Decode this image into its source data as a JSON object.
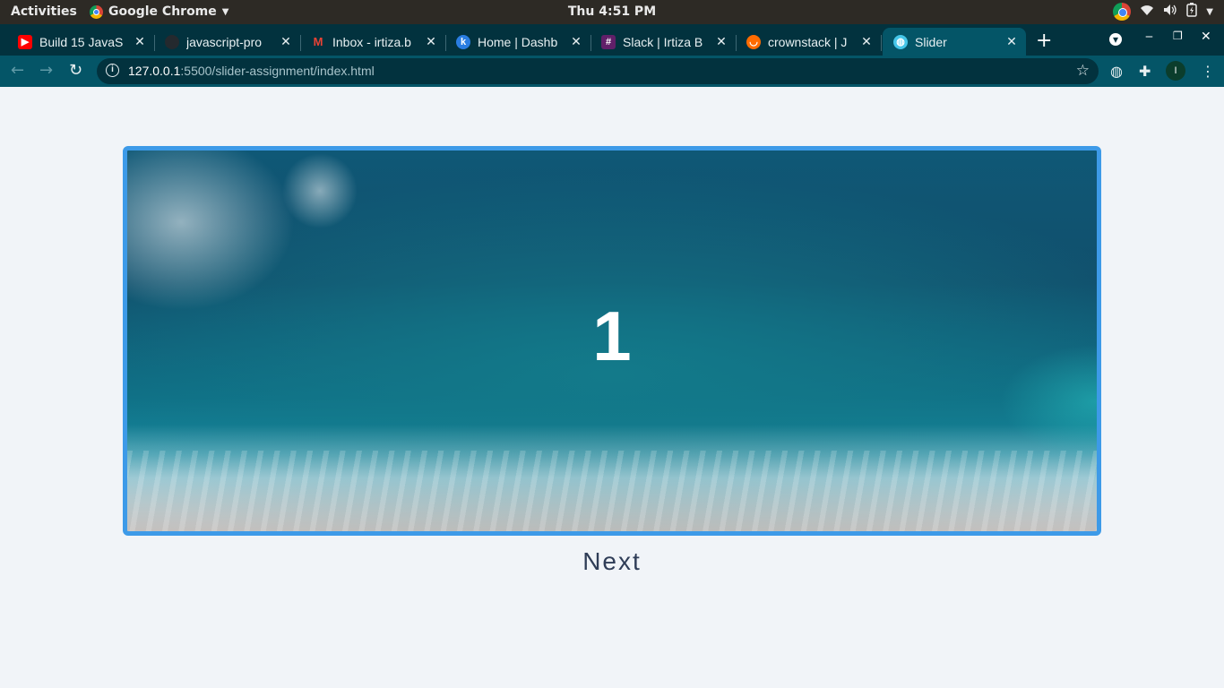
{
  "system_bar": {
    "activities": "Activities",
    "app_name": "Google Chrome",
    "clock": "Thu  4:51 PM"
  },
  "browser": {
    "tabs": [
      {
        "title": "Build 15 JavaS",
        "favicon": "youtube-icon",
        "color": "#ff0000"
      },
      {
        "title": "javascript-pro",
        "favicon": "github-icon",
        "color": "#24292e"
      },
      {
        "title": "Inbox - irtiza.b",
        "favicon": "gmail-icon",
        "color": "#ea4335"
      },
      {
        "title": "Home | Dashb",
        "favicon": "k-icon",
        "color": "#2a7de1"
      },
      {
        "title": "Slack | Irtiza B",
        "favicon": "slack-icon",
        "color": "#611f69"
      },
      {
        "title": "crownstack | J",
        "favicon": "crownstack-icon",
        "color": "#ff6b00"
      },
      {
        "title": "Slider",
        "favicon": "globe-icon",
        "color": "#45c6e8",
        "active": true
      }
    ],
    "url_host": "127.0.0.1",
    "url_path": ":5500/slider-assignment/index.html",
    "profile_initial": "I"
  },
  "slider": {
    "current_slide": "1",
    "next_label": "Next",
    "border_color": "#3d9ae8"
  }
}
